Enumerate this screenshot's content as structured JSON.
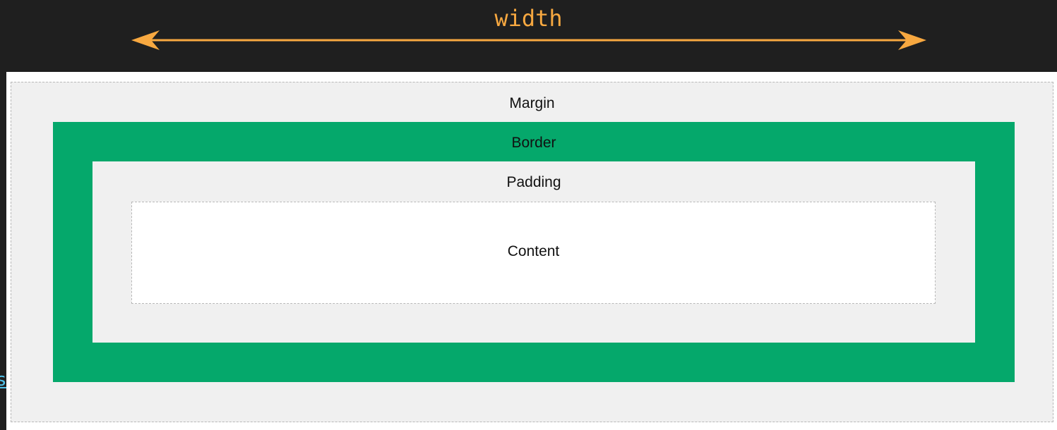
{
  "header": {
    "width_label": "width",
    "side_glyph": "s"
  },
  "colors": {
    "background": "#1f1f1f",
    "arrow": "#f7a840",
    "margin_fill": "#f0f0f0",
    "border_fill": "#05a86b",
    "padding_fill": "#f0f0f0",
    "content_fill": "#ffffff",
    "dashed_outline": "#b8b8b8",
    "side_glyph": "#4fc1e9"
  },
  "box_model": {
    "margin_label": "Margin",
    "border_label": "Border",
    "padding_label": "Padding",
    "content_label": "Content"
  }
}
